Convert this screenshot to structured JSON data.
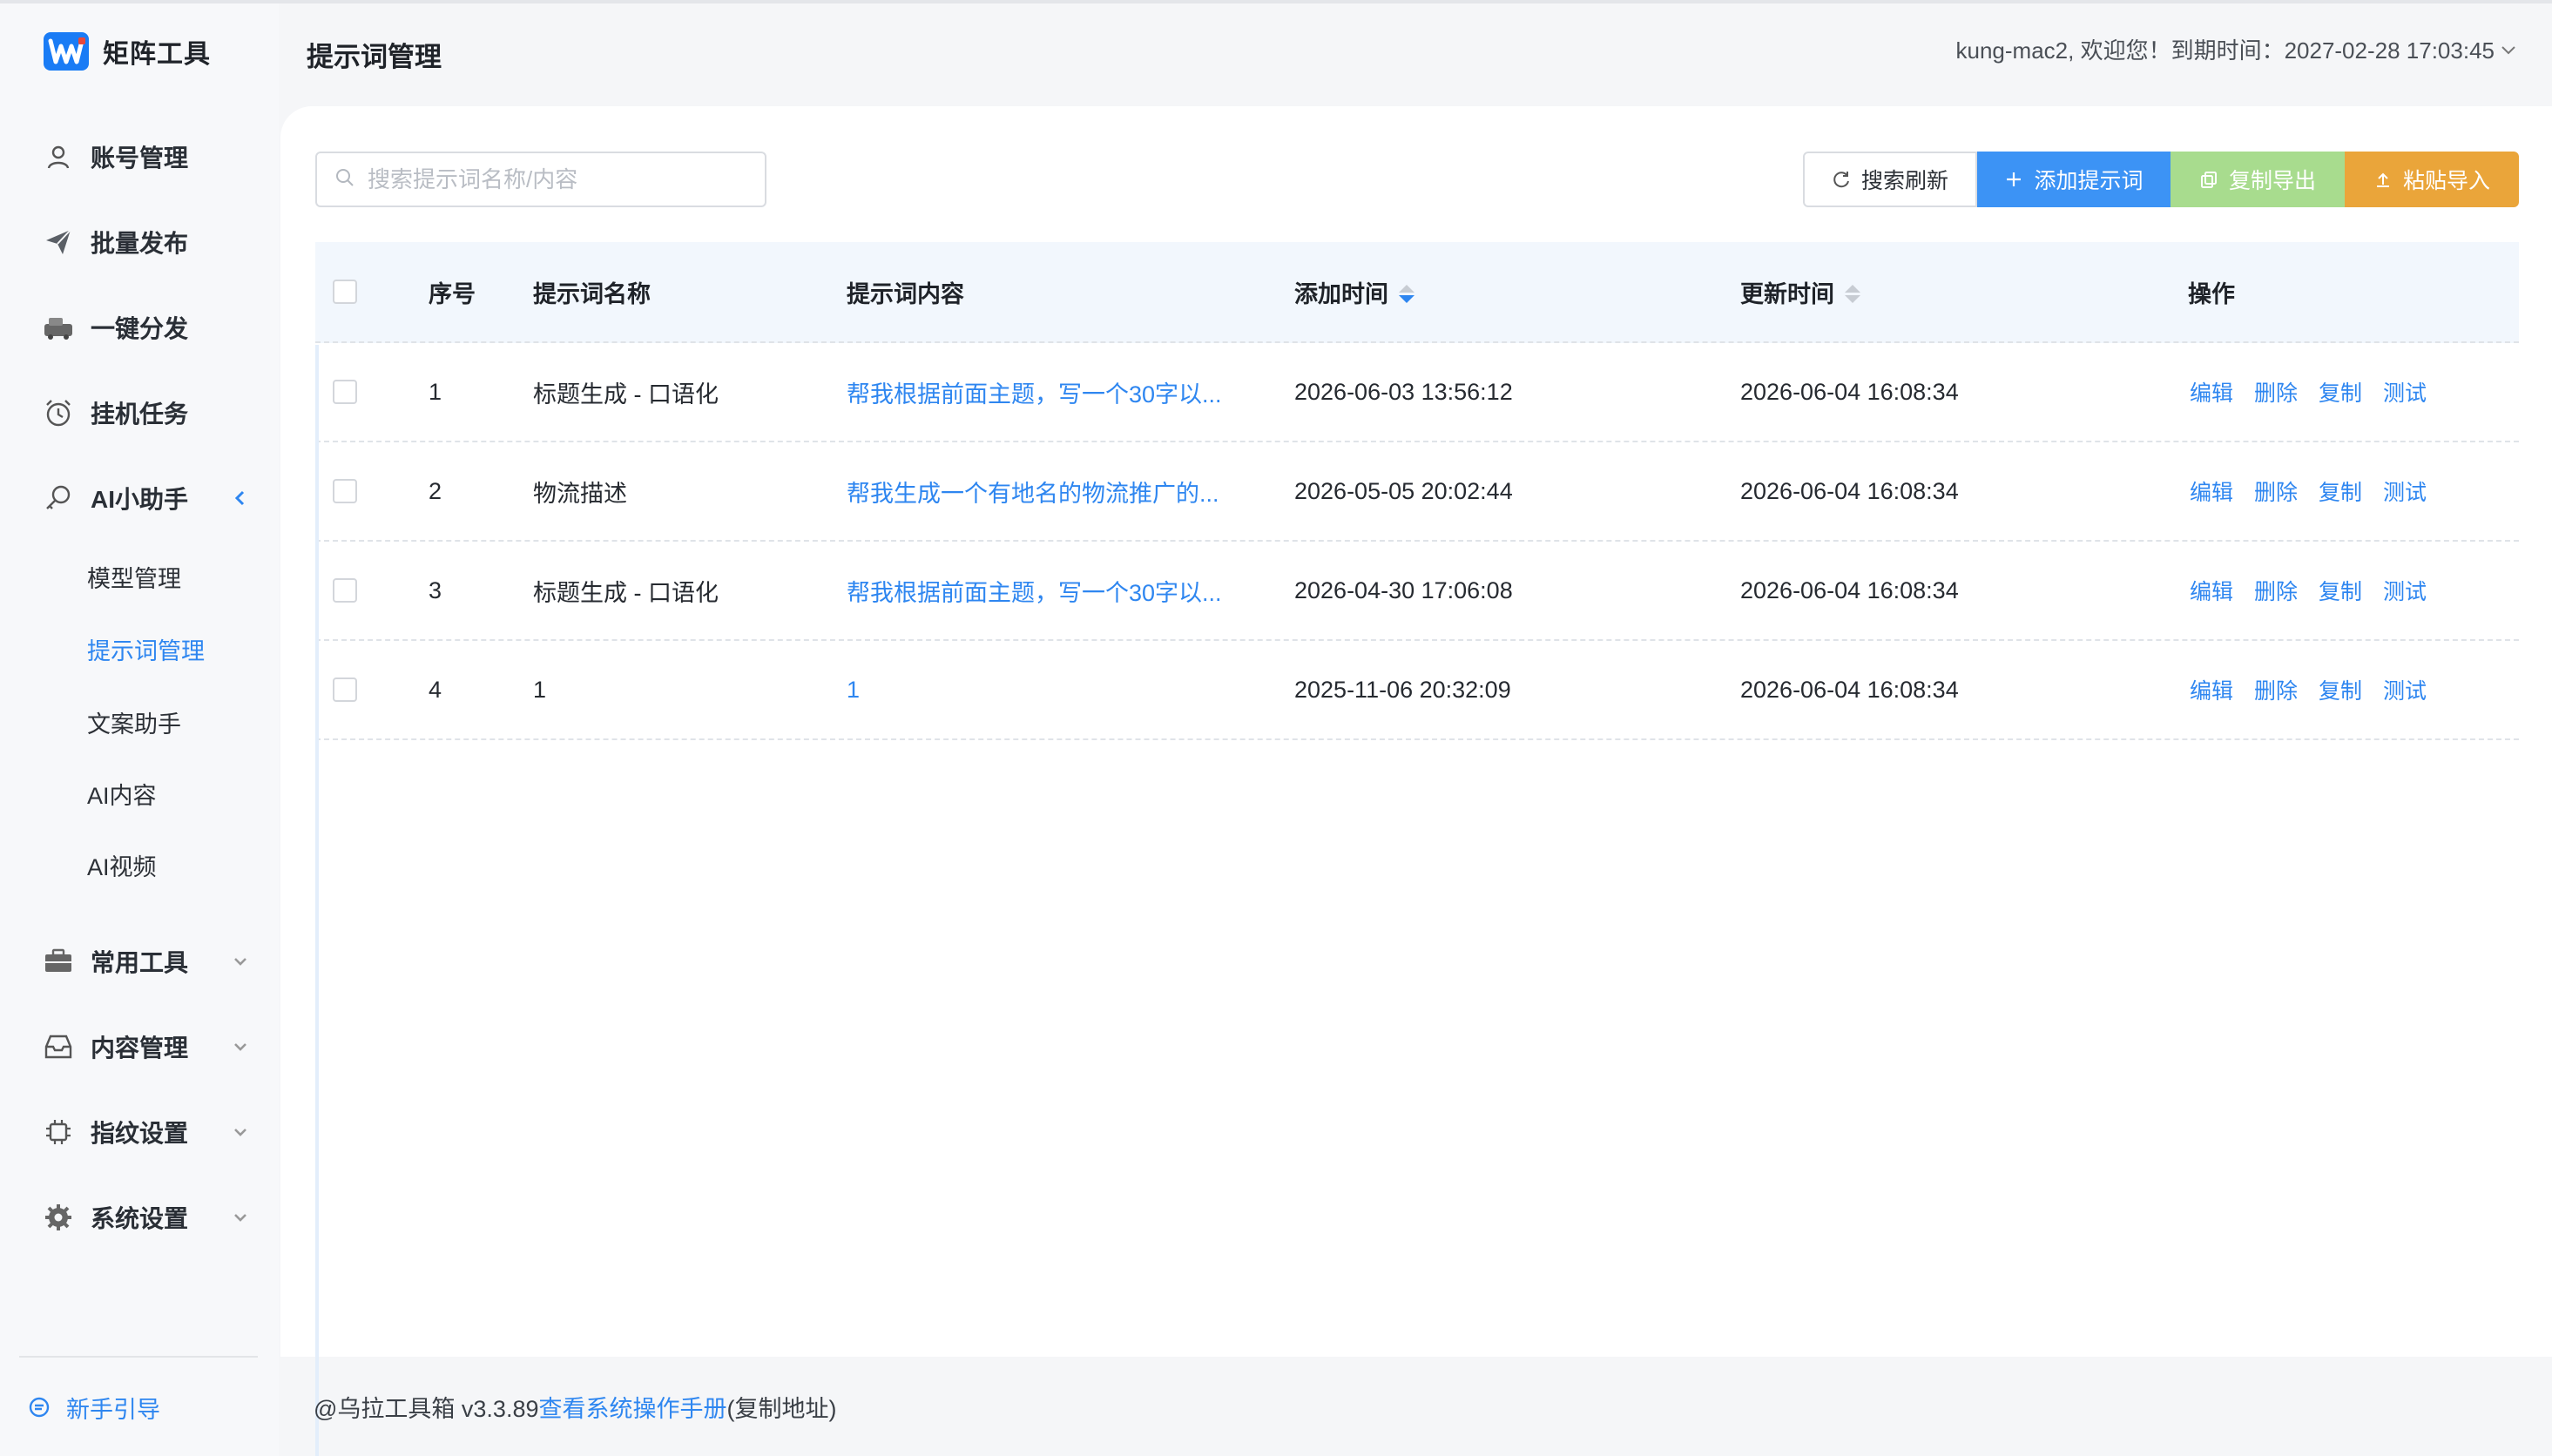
{
  "app": {
    "name": "矩阵工具",
    "brand_color": "#1a7cf5",
    "accent": "#2e86f0"
  },
  "header": {
    "title": "提示词管理",
    "user_info": "kung-mac2, 欢迎您！到期时间：2027-02-28 17:03:45"
  },
  "sidebar": {
    "items": [
      {
        "label": "账号管理",
        "icon": "user-icon"
      },
      {
        "label": "批量发布",
        "icon": "send-icon"
      },
      {
        "label": "一键分发",
        "icon": "car-icon"
      },
      {
        "label": "挂机任务",
        "icon": "alarm-clock-icon"
      },
      {
        "label": "AI小助手",
        "icon": "key-search-icon",
        "expanded": true
      },
      {
        "label": "常用工具",
        "icon": "briefcase-icon"
      },
      {
        "label": "内容管理",
        "icon": "inbox-icon"
      },
      {
        "label": "指纹设置",
        "icon": "chip-icon"
      },
      {
        "label": "系统设置",
        "icon": "gear-icon"
      }
    ],
    "ai_sub_items": [
      "模型管理",
      "提示词管理",
      "文案助手",
      "AI内容",
      "AI视频"
    ],
    "active_sub": "提示词管理",
    "guide": "新手引导"
  },
  "toolbar": {
    "search_placeholder": "搜索提示词名称/内容",
    "refresh": "搜索刷新",
    "add": "添加提示词",
    "export": "复制导出",
    "import": "粘贴导入"
  },
  "table": {
    "headers": {
      "index": "序号",
      "name": "提示词名称",
      "content": "提示词内容",
      "added": "添加时间",
      "updated": "更新时间",
      "ops": "操作"
    },
    "rows": [
      {
        "index": "1",
        "name": "标题生成 - 口语化",
        "content": "帮我根据前面主题，写一个30字以...",
        "added": "2026-06-03 13:56:12",
        "updated": "2026-06-04 16:08:34"
      },
      {
        "index": "2",
        "name": "物流描述",
        "content": "帮我生成一个有地名的物流推广的...",
        "added": "2026-05-05 20:02:44",
        "updated": "2026-06-04 16:08:34"
      },
      {
        "index": "3",
        "name": "标题生成 - 口语化",
        "content": "帮我根据前面主题，写一个30字以...",
        "added": "2026-04-30 17:06:08",
        "updated": "2026-06-04 16:08:34"
      },
      {
        "index": "4",
        "name": "1",
        "content": "1",
        "added": "2025-11-06 20:32:09",
        "updated": "2026-06-04 16:08:34"
      }
    ],
    "ops": {
      "edit": "编辑",
      "delete": "删除",
      "copy": "复制",
      "test": "测试"
    }
  },
  "footer": {
    "prefix": "@乌拉工具箱 v3.3.89",
    "manual_link": "查看系统操作手册",
    "suffix": "(复制地址)"
  }
}
